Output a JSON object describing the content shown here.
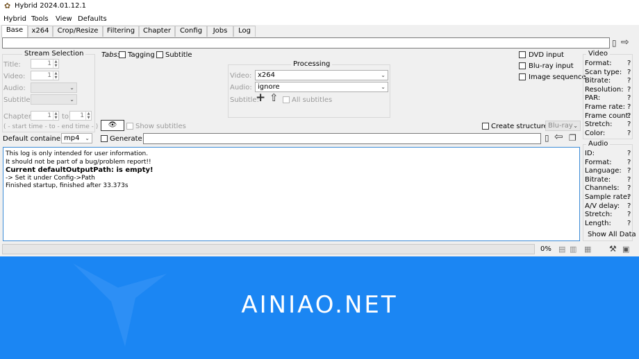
{
  "window": {
    "title": "Hybrid 2024.01.12.1"
  },
  "menu": [
    "Hybrid",
    "Tools",
    "View",
    "Defaults"
  ],
  "tabs": [
    "Base",
    "x264",
    "Crop/Resize",
    "Filtering",
    "Chapter",
    "Config",
    "Jobs",
    "Log"
  ],
  "active_tab": "Base",
  "path_input": {
    "value": ""
  },
  "stream_selection": {
    "title": "Stream Selection",
    "title_label": "Title:",
    "title_value": "1",
    "video_label": "Video:",
    "video_value": "1",
    "audio_label": "Audio:",
    "subtitle_label": "Subtitle:",
    "chapter_label": "Chapter:",
    "chapter_from": "1",
    "to_label": "to",
    "chapter_to": "1",
    "hint": "( - start time - to - end time - )"
  },
  "tabs_options": {
    "label": "Tabs:",
    "tagging": "Tagging",
    "subtitle": "Subtitle"
  },
  "processing": {
    "title": "Processing",
    "video_label": "Video:",
    "video_value": "x264",
    "audio_label": "Audio:",
    "audio_value": "ignore",
    "subtitle_label": "Subtitle:",
    "all_subtitles": "All subtitles"
  },
  "input_opts": {
    "dvd": "DVD input",
    "bluray": "Blu-ray input",
    "image_seq": "Image sequence"
  },
  "show_subtitles": "Show subtitles",
  "create_structure": {
    "label": "Create structure:",
    "value": "Blu-ray"
  },
  "container": {
    "label": "Default container:",
    "value": "mp4"
  },
  "generate": {
    "label": "Generate:",
    "value": ""
  },
  "log": [
    {
      "text": "This log is only intended for user information.",
      "bold": false
    },
    {
      "text": "It should not be part of a bug/problem report!!",
      "bold": false
    },
    {
      "text": "Current defaultOutputPath: is empty!",
      "bold": true
    },
    {
      "text": " -> Set it under Config->Path",
      "bold": false
    },
    {
      "text": "Finished startup, finished after 33.373s",
      "bold": false
    }
  ],
  "video_info": {
    "title": "Video",
    "rows": [
      "Format:",
      "Scan type:",
      "Bitrate:",
      "Resolution:",
      "PAR:",
      "Frame rate:",
      "Frame count:",
      "Stretch:",
      "Color:"
    ],
    "value": "?"
  },
  "audio_info": {
    "title": "Audio",
    "rows": [
      "ID:",
      "Format:",
      "Language:",
      "Bitrate:",
      "Channels:",
      "Sample rate:",
      "A/V delay:",
      "Stretch:",
      "Length:"
    ],
    "value": "?",
    "show_all": "Show All Data"
  },
  "progress": {
    "value": 0,
    "label": "0%"
  },
  "banner": {
    "text": "AINIAO.NET",
    "color": "#1b86f3"
  },
  "colors": {
    "accent": "#3c8cd8"
  }
}
